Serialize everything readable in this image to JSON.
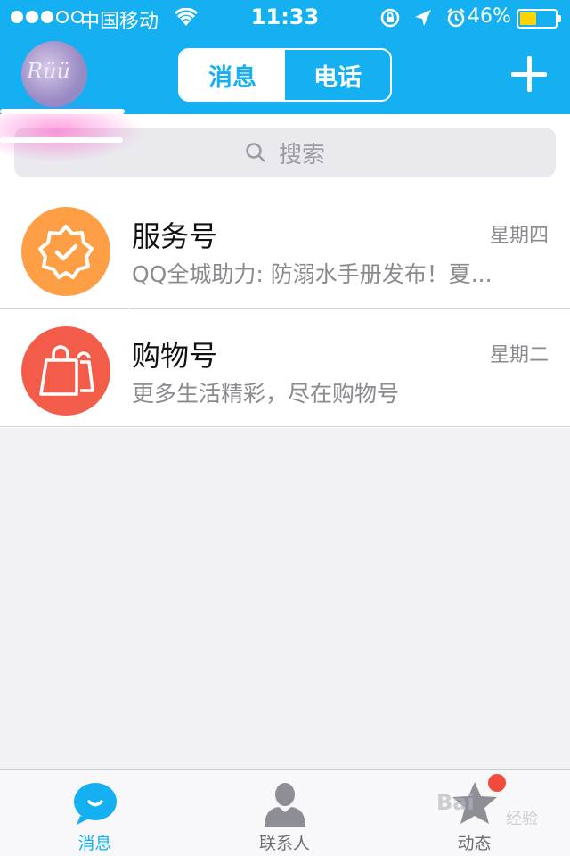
{
  "status_bar": {
    "carrier": "中国移动",
    "time": "11:33",
    "battery_percent": "46%",
    "battery_level": 0.46,
    "signal_bars_filled": 3,
    "signal_bars_total": 5
  },
  "header": {
    "tabs": [
      {
        "label": "消息",
        "active": true
      },
      {
        "label": "电话",
        "active": false
      }
    ],
    "add_icon": "plus-icon"
  },
  "search": {
    "placeholder": "搜索"
  },
  "conversations": [
    {
      "name": "服务号",
      "date": "星期四",
      "preview": "QQ全城助力: 防溺水手册发布！夏...",
      "icon": "verified-badge-icon",
      "color": "#ff9f45"
    },
    {
      "name": "购物号",
      "date": "星期二",
      "preview": "更多生活精彩，尽在购物号",
      "icon": "shopping-bag-icon",
      "color": "#f45c4a"
    }
  ],
  "tabbar": {
    "items": [
      {
        "label": "消息",
        "icon": "message-bubble-icon",
        "active": true
      },
      {
        "label": "联系人",
        "icon": "contact-person-icon",
        "active": false
      },
      {
        "label": "动态",
        "icon": "star-icon",
        "active": false,
        "has_badge": true
      }
    ]
  },
  "watermark": {
    "text": "Bai",
    "subtext": "经验"
  },
  "colors": {
    "accent": "#14b0f1",
    "badge": "#f04b3b"
  }
}
